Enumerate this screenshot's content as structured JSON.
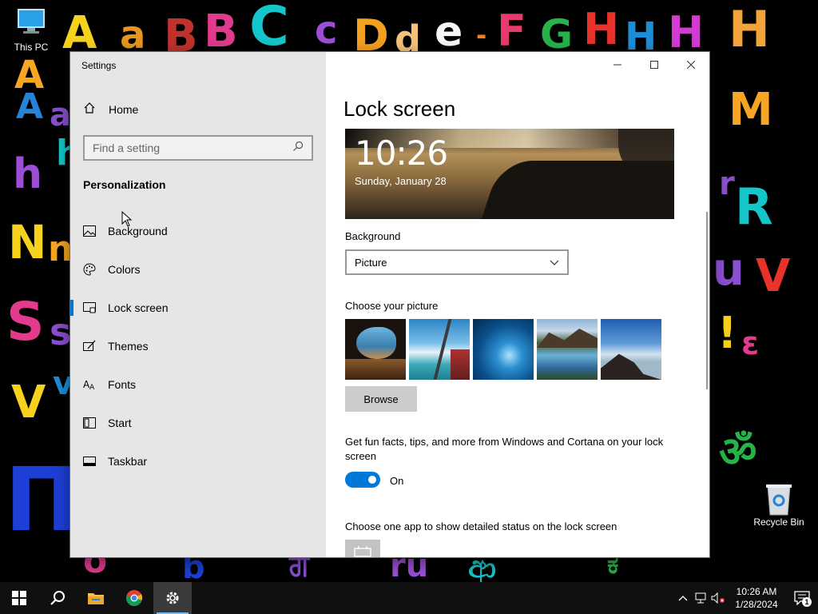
{
  "desktop": {
    "icons": [
      {
        "label": "This PC",
        "icon": "computer-icon"
      },
      {
        "label": "Recycle Bin",
        "icon": "recycle-bin-icon"
      }
    ]
  },
  "window": {
    "title": "Settings",
    "controls": [
      "minimize-icon",
      "maximize-icon",
      "close-icon"
    ]
  },
  "sidebar": {
    "home_label": "Home",
    "search_placeholder": "Find a setting",
    "section_title": "Personalization",
    "items": [
      {
        "label": "Background",
        "icon": "image-icon",
        "active": false
      },
      {
        "label": "Colors",
        "icon": "palette-icon",
        "active": false
      },
      {
        "label": "Lock screen",
        "icon": "lock-screen-icon",
        "active": true
      },
      {
        "label": "Themes",
        "icon": "themes-icon",
        "active": false
      },
      {
        "label": "Fonts",
        "icon": "fonts-icon",
        "active": false
      },
      {
        "label": "Start",
        "icon": "start-icon",
        "active": false
      },
      {
        "label": "Taskbar",
        "icon": "taskbar-icon",
        "active": false
      }
    ]
  },
  "content": {
    "title": "Lock screen",
    "preview": {
      "time": "10:26",
      "date": "Sunday, January 28"
    },
    "background_label": "Background",
    "background_value": "Picture",
    "choose_picture_label": "Choose your picture",
    "browse_label": "Browse",
    "fun_facts_label": "Get fun facts, tips, and more from Windows and Cortana on your lock screen",
    "toggle_state": "On",
    "toggle_on": true,
    "app_status_label": "Choose one app to show detailed status on the lock screen"
  },
  "taskbar": {
    "apps": [
      "start-icon",
      "search-icon",
      "file-explorer-icon",
      "chrome-icon",
      "settings-icon"
    ],
    "clock_time": "10:26 AM",
    "clock_date": "1/28/2024",
    "notification_count": "1"
  },
  "colors": {
    "accent": "#0078d7",
    "sidebar_bg": "#e6e6e6",
    "taskbar_bg": "#101010"
  }
}
